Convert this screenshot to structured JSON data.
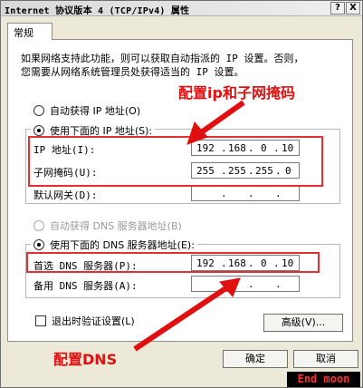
{
  "window": {
    "title": "Internet 协议版本 4 (TCP/IPv4) 属性",
    "help_symbol": "?",
    "close_symbol": "X"
  },
  "tabs": [
    {
      "label": "常规",
      "active": true
    }
  ],
  "description": [
    "如果网络支持此功能，则可以获取自动指派的 IP 设置。否则，",
    "您需要从网络系统管理员处获得适当的 IP 设置。"
  ],
  "ip": {
    "auto_label": "自动获得 IP 地址(O)",
    "manual_label": "使用下面的 IP 地址(S):",
    "fields": [
      {
        "label": "IP 地址(I):",
        "octets": [
          "192",
          "168",
          "0",
          "10"
        ]
      },
      {
        "label": "子网掩码(U):",
        "octets": [
          "255",
          "255",
          "255",
          "0"
        ]
      },
      {
        "label": "默认网关(D):",
        "octets": [
          "",
          "",
          "",
          ""
        ]
      }
    ]
  },
  "dns": {
    "auto_label": "自动获得 DNS 服务器地址(B)",
    "manual_label": "使用下面的 DNS 服务器地址(E):",
    "fields": [
      {
        "label": "首选 DNS 服务器(P):",
        "octets": [
          "192",
          "168",
          "0",
          "10"
        ]
      },
      {
        "label": "备用 DNS 服务器(A):",
        "octets": [
          "",
          "",
          "",
          ""
        ]
      }
    ]
  },
  "validate_label": "退出时验证设置(L)",
  "buttons": {
    "advanced": "高级(V)...",
    "ok": "确定",
    "cancel": "取消"
  },
  "annotations": {
    "ip_mask": "配置ip和子网掩码",
    "dns": "配置DNS"
  },
  "watermark": "End moon",
  "colors": {
    "annotation": "#e01010",
    "highlight_box": "#e53030",
    "window_bg": "#ece9d8"
  }
}
